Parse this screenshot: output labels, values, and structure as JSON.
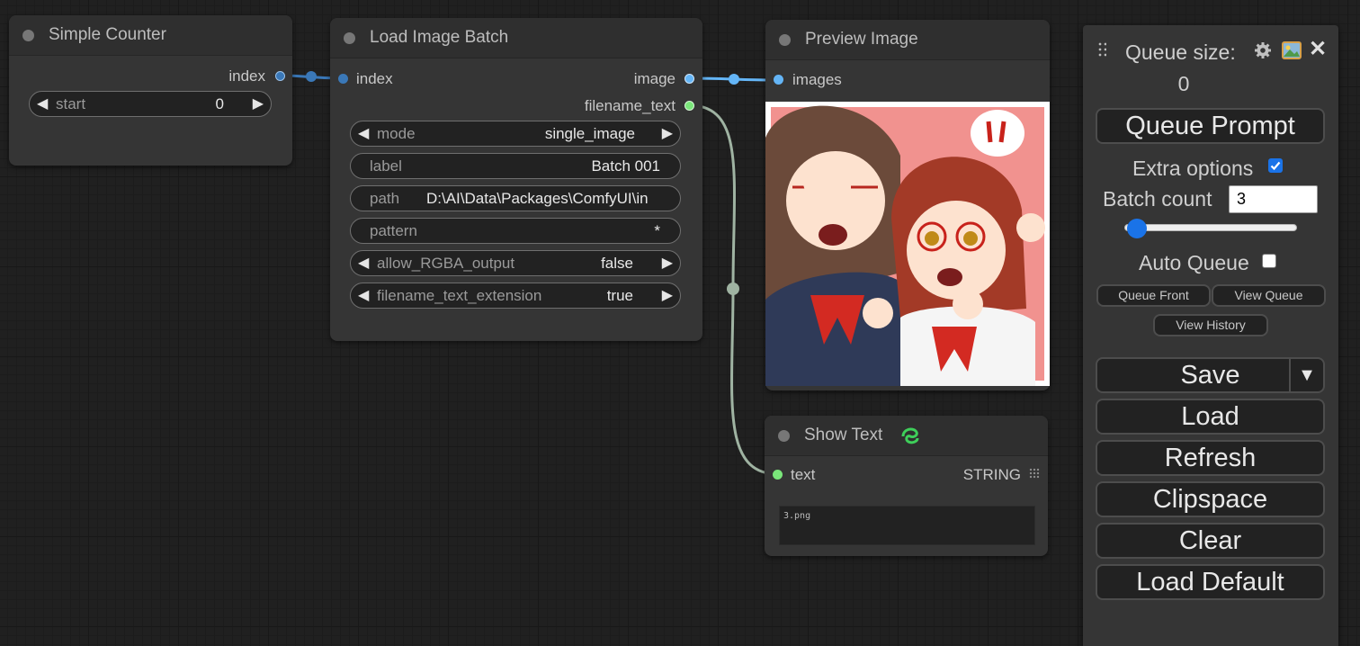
{
  "nodes": {
    "simple_counter": {
      "title": "Simple Counter",
      "output": "index",
      "widgets": [
        {
          "label": "start",
          "value": "0"
        }
      ]
    },
    "load_image_batch": {
      "title": "Load Image Batch",
      "input": "index",
      "outputs": [
        "image",
        "filename_text"
      ],
      "widgets": [
        {
          "label": "mode",
          "value": "single_image"
        },
        {
          "label": "label",
          "value": "Batch 001"
        },
        {
          "label": "path",
          "value": "D:\\AI\\Data\\Packages\\ComfyUI\\in"
        },
        {
          "label": "pattern",
          "value": "*"
        },
        {
          "label": "allow_RGBA_output",
          "value": "false"
        },
        {
          "label": "filename_text_extension",
          "value": "true"
        }
      ]
    },
    "preview_image": {
      "title": "Preview Image",
      "input": "images"
    },
    "show_text": {
      "title": "Show Text",
      "input": "text",
      "output": "STRING",
      "text_value": "3.png"
    }
  },
  "queue_panel": {
    "queue_size_label": "Queue size:",
    "queue_size": "0",
    "queue_prompt": "Queue Prompt",
    "extra_options_label": "Extra options",
    "extra_options_checked": true,
    "batch_count_label": "Batch count",
    "batch_count_value": "3",
    "batch_slider_fraction": 0.02,
    "auto_queue_label": "Auto Queue",
    "auto_queue_checked": false,
    "queue_front": "Queue Front",
    "view_queue": "View Queue",
    "view_history": "View History",
    "save": "Save",
    "load": "Load",
    "refresh": "Refresh",
    "clipspace": "Clipspace",
    "clear": "Clear",
    "load_default": "Load Default"
  },
  "icons": {
    "settings": "gear-icon",
    "image": "image-icon",
    "close": "close-icon",
    "drag": "drag-handle-icon",
    "widget_left": "arrow-left-icon",
    "widget_right": "arrow-right-icon",
    "save_dropdown": "triangle-down-icon",
    "custom_node_badge": "pysssss-snake-icon"
  },
  "colors": {
    "canvas": "#202020",
    "node_body": "#353535",
    "node_title": "#2f2f2f",
    "int_link": "#3a78b8",
    "image_link": "#64b5f6",
    "string_link": "#9fb3a2",
    "string_slot": "#7ae67a",
    "accent_blue": "#1a73e8"
  }
}
